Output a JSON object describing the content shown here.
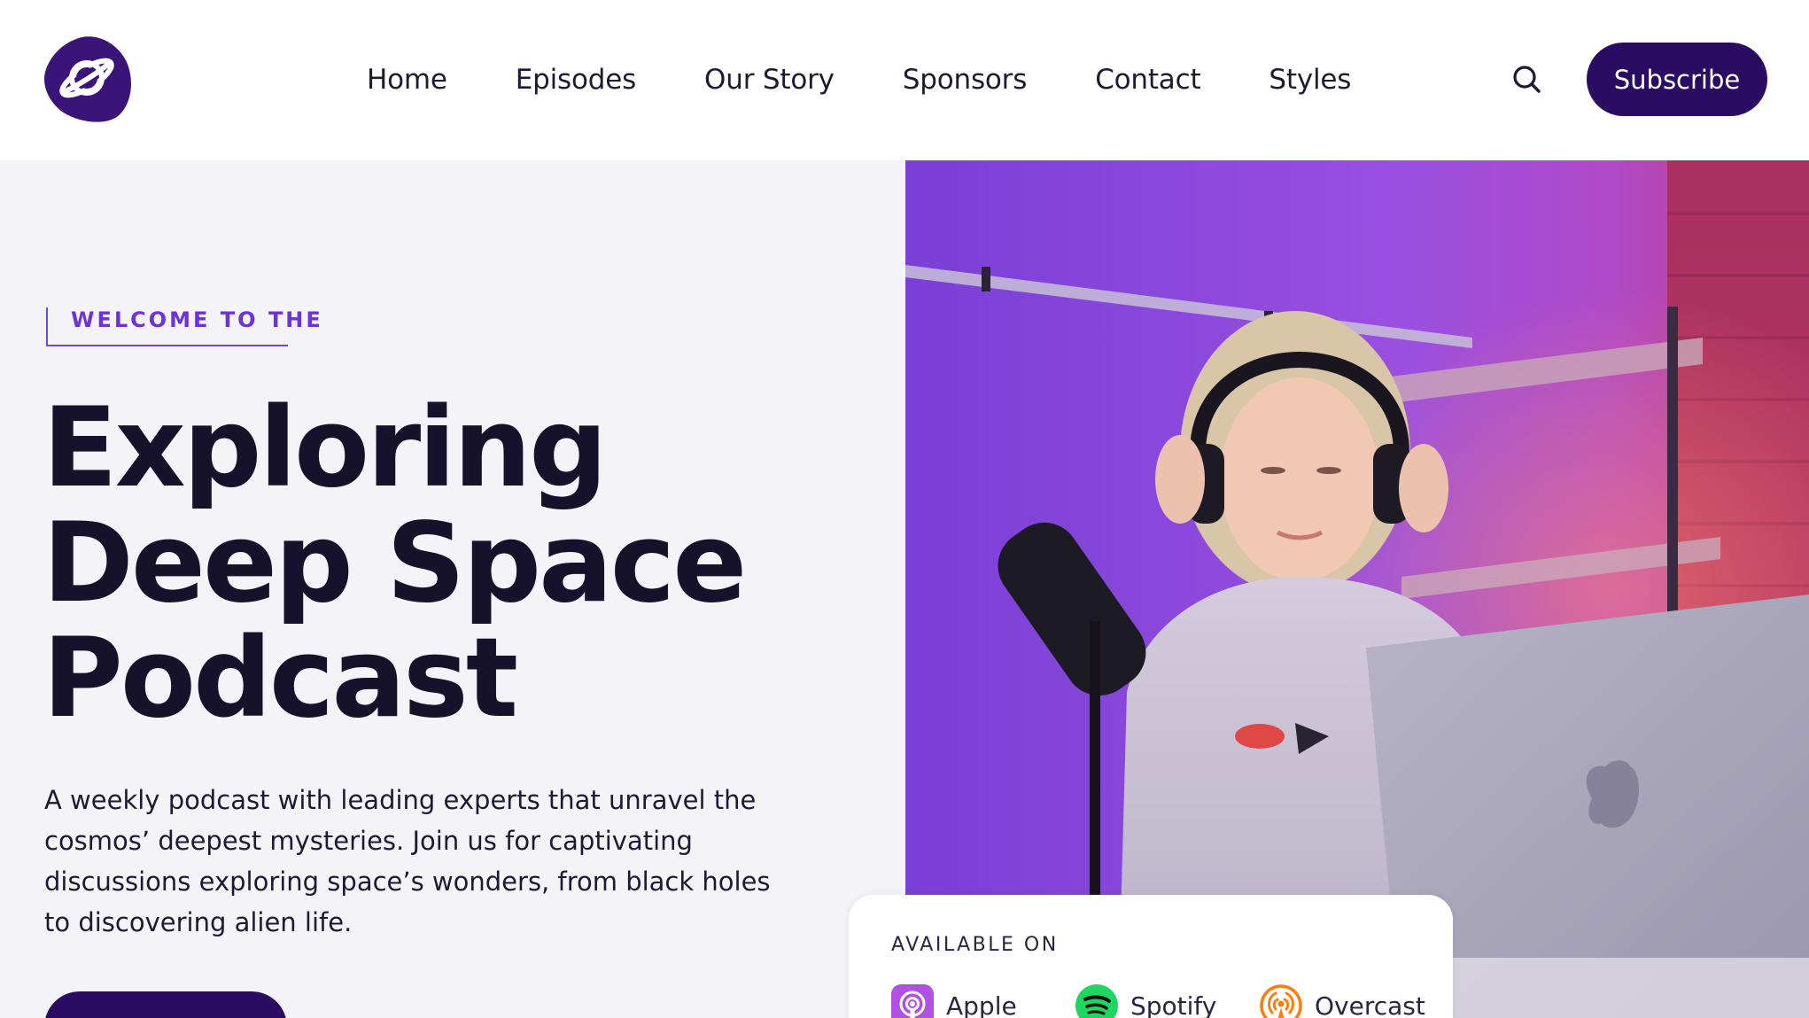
{
  "header": {
    "nav": [
      "Home",
      "Episodes",
      "Our Story",
      "Sponsors",
      "Contact",
      "Styles"
    ],
    "subscribe_label": "Subscribe"
  },
  "hero": {
    "eyebrow": "WELCOME TO THE",
    "headline_lines": [
      "Exploring",
      "Deep Space",
      "Podcast"
    ],
    "description": "A weekly podcast with leading experts that unravel the cosmos’ deepest mysteries. Join us for captivating discussions exploring space’s wonders, from black holes to discovering alien life."
  },
  "available": {
    "title": "AVAILABLE ON",
    "platforms": [
      {
        "label": "Apple",
        "icon": "apple-podcasts-icon",
        "color": "#b150e2"
      },
      {
        "label": "Spotify",
        "icon": "spotify-icon",
        "color": "#1ed760"
      },
      {
        "label": "Overcast",
        "icon": "overcast-icon",
        "color": "#fc7e0f"
      }
    ]
  },
  "colors": {
    "accent_dark": "#2a0c63",
    "accent_purple": "#6a34d8",
    "hero_bg": "#f4f3f8"
  },
  "icons": {
    "logo": "planet-logo-icon",
    "search": "search-icon"
  }
}
